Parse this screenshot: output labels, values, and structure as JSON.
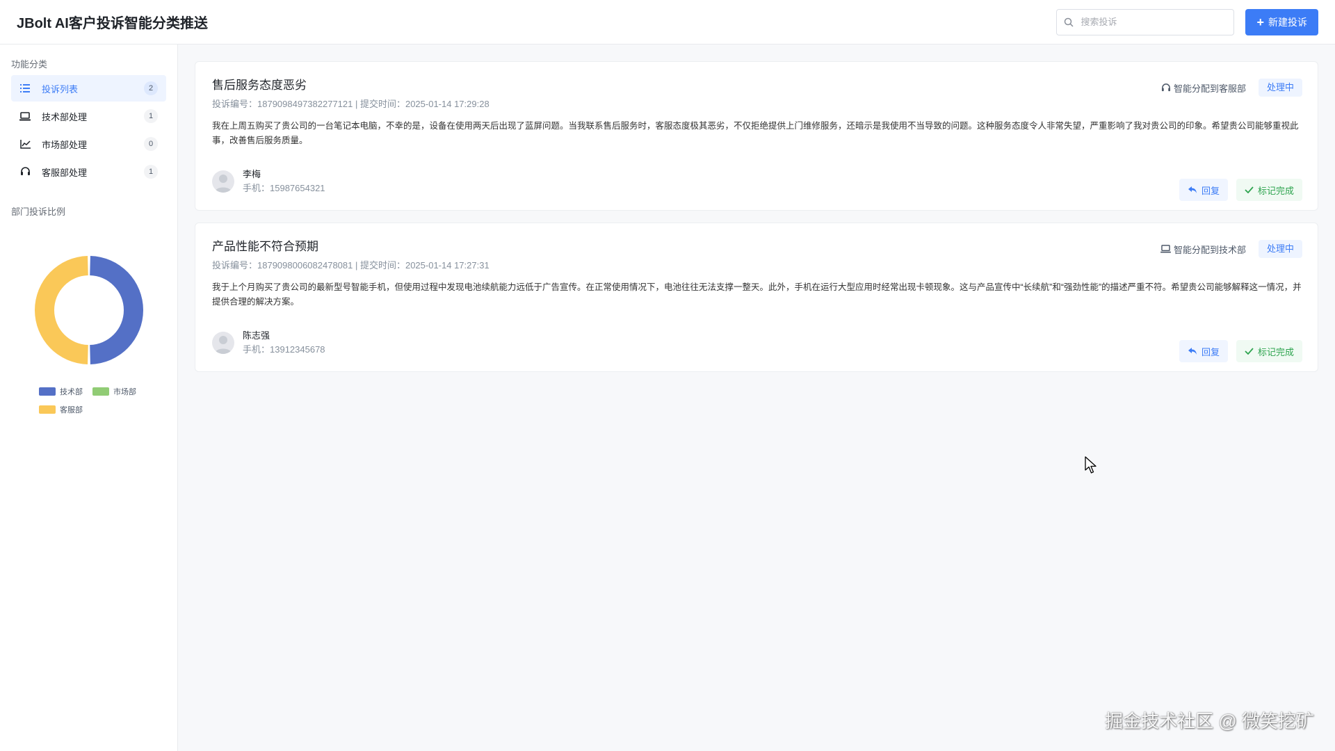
{
  "header": {
    "app_title": "JBolt AI客户投诉智能分类推送",
    "search_placeholder": "搜索投诉",
    "new_button_label": "新建投诉"
  },
  "sidebar": {
    "functions_title": "功能分类",
    "items": [
      {
        "label": "投诉列表",
        "count": "2",
        "icon": "list-icon",
        "active": true
      },
      {
        "label": "技术部处理",
        "count": "1",
        "icon": "laptop-icon"
      },
      {
        "label": "市场部处理",
        "count": "0",
        "icon": "line-chart-icon"
      },
      {
        "label": "客服部处理",
        "count": "1",
        "icon": "headset-icon"
      }
    ],
    "chart_title": "部门投诉比例"
  },
  "chart_data": {
    "type": "pie",
    "variant": "donut",
    "categories": [
      "技术部",
      "市场部",
      "客服部"
    ],
    "values": [
      1,
      0,
      1
    ],
    "colors": [
      "#5470c6",
      "#91cc75",
      "#fac858"
    ],
    "legend_position": "bottom"
  },
  "complaints": [
    {
      "title": "售后服务态度恶劣",
      "meta": "投诉编号：1879098497382277121 | 提交时间：2025-01-14 17:29:28",
      "body": "我在上周五购买了贵公司的一台笔记本电脑，不幸的是，设备在使用两天后出现了蓝屏问题。当我联系售后服务时，客服态度极其恶劣，不仅拒绝提供上门维修服务，还暗示是我使用不当导致的问题。这种服务态度令人非常失望，严重影响了我对贵公司的印象。希望贵公司能够重视此事，改善售后服务质量。",
      "assign_label": "智能分配到客服部",
      "assign_icon": "headset-icon",
      "status": "处理中",
      "user_name": "李梅",
      "user_phone": "手机：15987654321",
      "reply_label": "回复",
      "done_label": "标记完成"
    },
    {
      "title": "产品性能不符合预期",
      "meta": "投诉编号：1879098006082478081 | 提交时间：2025-01-14 17:27:31",
      "body": "我于上个月购买了贵公司的最新型号智能手机，但使用过程中发现电池续航能力远低于广告宣传。在正常使用情况下，电池往往无法支撑一整天。此外，手机在运行大型应用时经常出现卡顿现象。这与产品宣传中“长续航”和“强劲性能”的描述严重不符。希望贵公司能够解释这一情况，并提供合理的解决方案。",
      "assign_label": "智能分配到技术部",
      "assign_icon": "laptop-icon",
      "status": "处理中",
      "user_name": "陈志强",
      "user_phone": "手机：13912345678",
      "reply_label": "回复",
      "done_label": "标记完成"
    }
  ],
  "watermark": "掘金技术社区 @ 微笑挖矿"
}
